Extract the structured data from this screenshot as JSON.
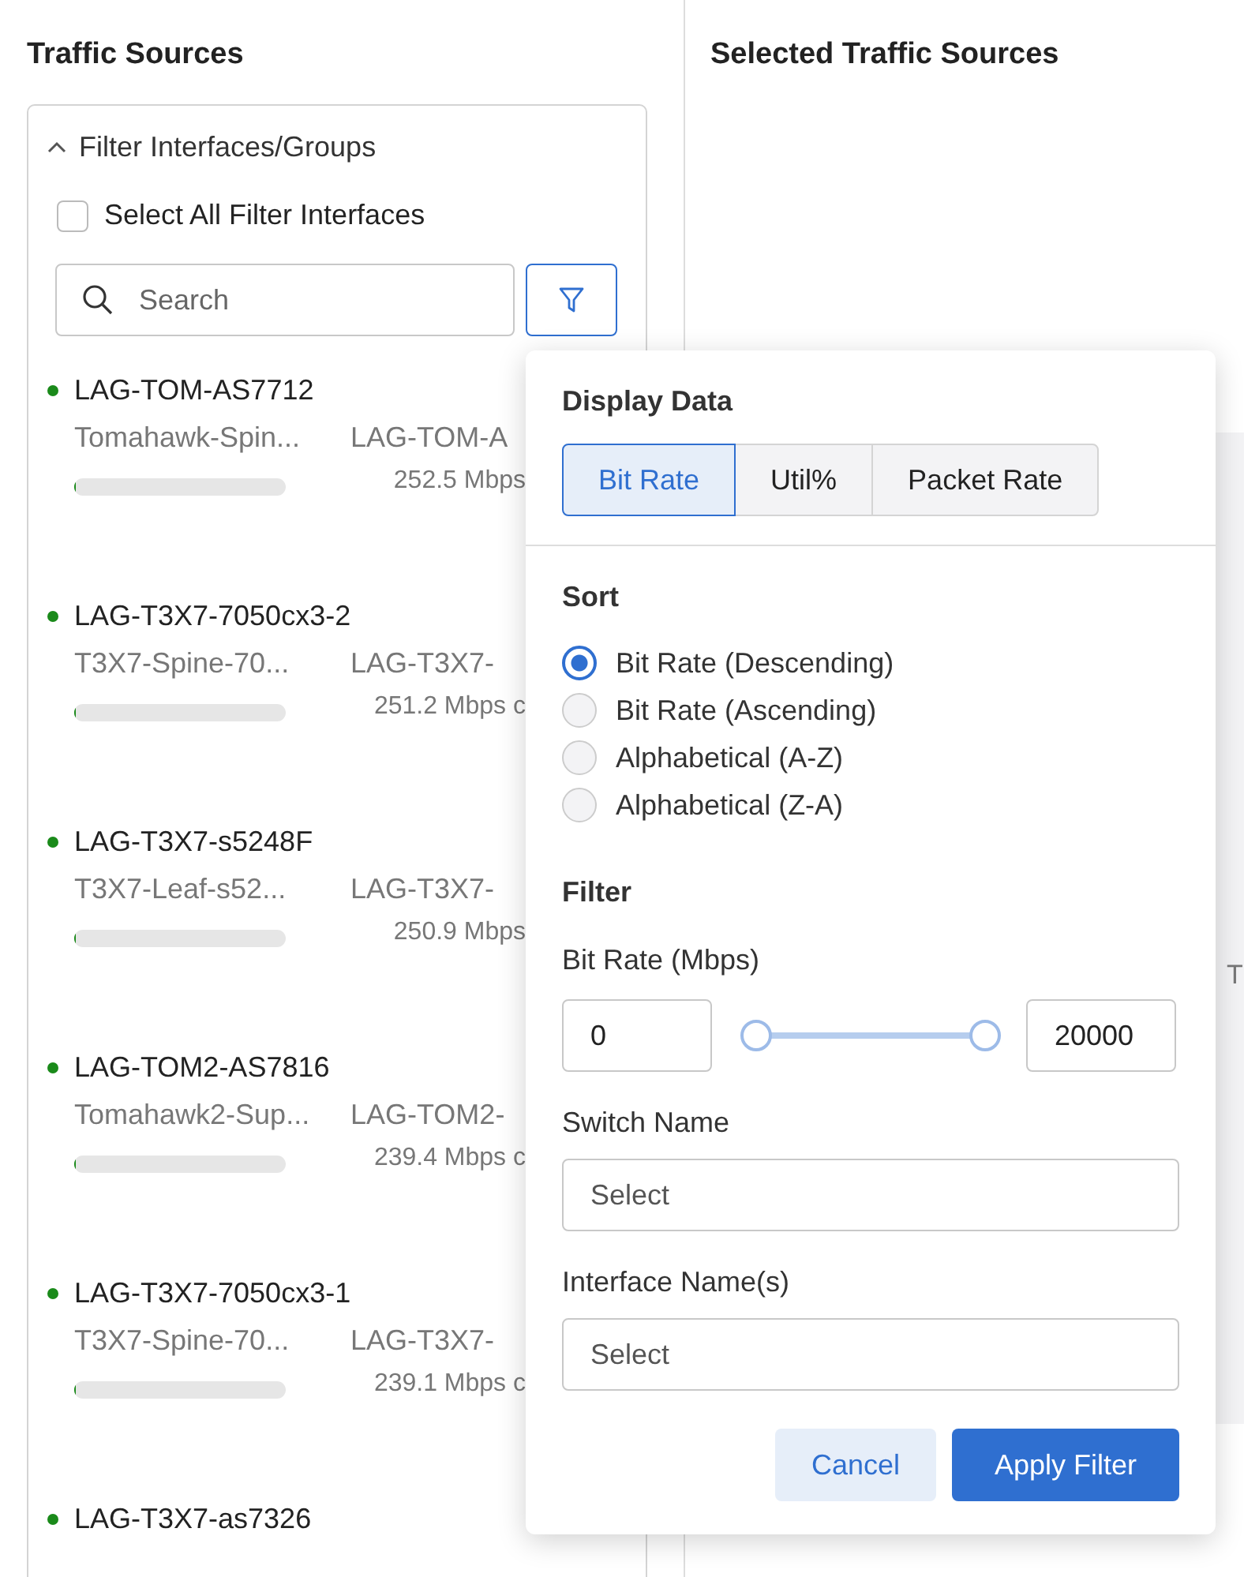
{
  "left_panel": {
    "title": "Traffic Sources",
    "filter_group": {
      "label": "Filter Interfaces/Groups",
      "expanded": true
    },
    "select_all": {
      "label": "Select All Filter Interfaces",
      "checked": false
    },
    "search": {
      "placeholder": "Search"
    },
    "filter_button": {
      "active": true
    },
    "items": [
      {
        "name": "LAG-TOM-AS7712",
        "switch": "Tomahawk-Spin...",
        "interface": "LAG-TOM-A",
        "rate": "252.5 Mbps",
        "level": 0.01,
        "color": "#1a8a1a"
      },
      {
        "name": "LAG-T3X7-7050cx3-2",
        "switch": "T3X7-Spine-70...",
        "interface": "LAG-T3X7-",
        "rate": "251.2 Mbps c",
        "level": 0.01,
        "color": "#1a8a1a"
      },
      {
        "name": "LAG-T3X7-s5248F",
        "switch": "T3X7-Leaf-s52...",
        "interface": "LAG-T3X7-",
        "rate": "250.9 Mbps",
        "level": 0.01,
        "color": "#1a8a1a"
      },
      {
        "name": "LAG-TOM2-AS7816",
        "switch": "Tomahawk2-Sup...",
        "interface": "LAG-TOM2-",
        "rate": "239.4 Mbps c",
        "level": 0.01,
        "color": "#1a8a1a"
      },
      {
        "name": "LAG-T3X7-7050cx3-1",
        "switch": "T3X7-Spine-70...",
        "interface": "LAG-T3X7-",
        "rate": "239.1 Mbps c",
        "level": 0.01,
        "color": "#1a8a1a"
      },
      {
        "name": "LAG-T3X7-as7326",
        "color": "#1a8a1a"
      }
    ]
  },
  "right_panel": {
    "title": "Selected Traffic Sources",
    "panel_text": "T"
  },
  "popover": {
    "display_title": "Display Data",
    "display_options": [
      {
        "label": "Bit Rate",
        "selected": true
      },
      {
        "label": "Util%",
        "selected": false
      },
      {
        "label": "Packet Rate",
        "selected": false
      }
    ],
    "sort_title": "Sort",
    "sort_options": [
      {
        "label": "Bit Rate (Descending)",
        "selected": true
      },
      {
        "label": "Bit Rate (Ascending)",
        "selected": false
      },
      {
        "label": "Alphabetical (A-Z)",
        "selected": false
      },
      {
        "label": "Alphabetical (Z-A)",
        "selected": false
      }
    ],
    "filter_title": "Filter",
    "bitrate_label": "Bit Rate (Mbps)",
    "min_value": "0",
    "max_value": "20000",
    "switch_label": "Switch Name",
    "switch_placeholder": "Select",
    "interface_label": "Interface Name(s)",
    "interface_placeholder": "Select",
    "cancel": "Cancel",
    "apply": "Apply Filter"
  }
}
